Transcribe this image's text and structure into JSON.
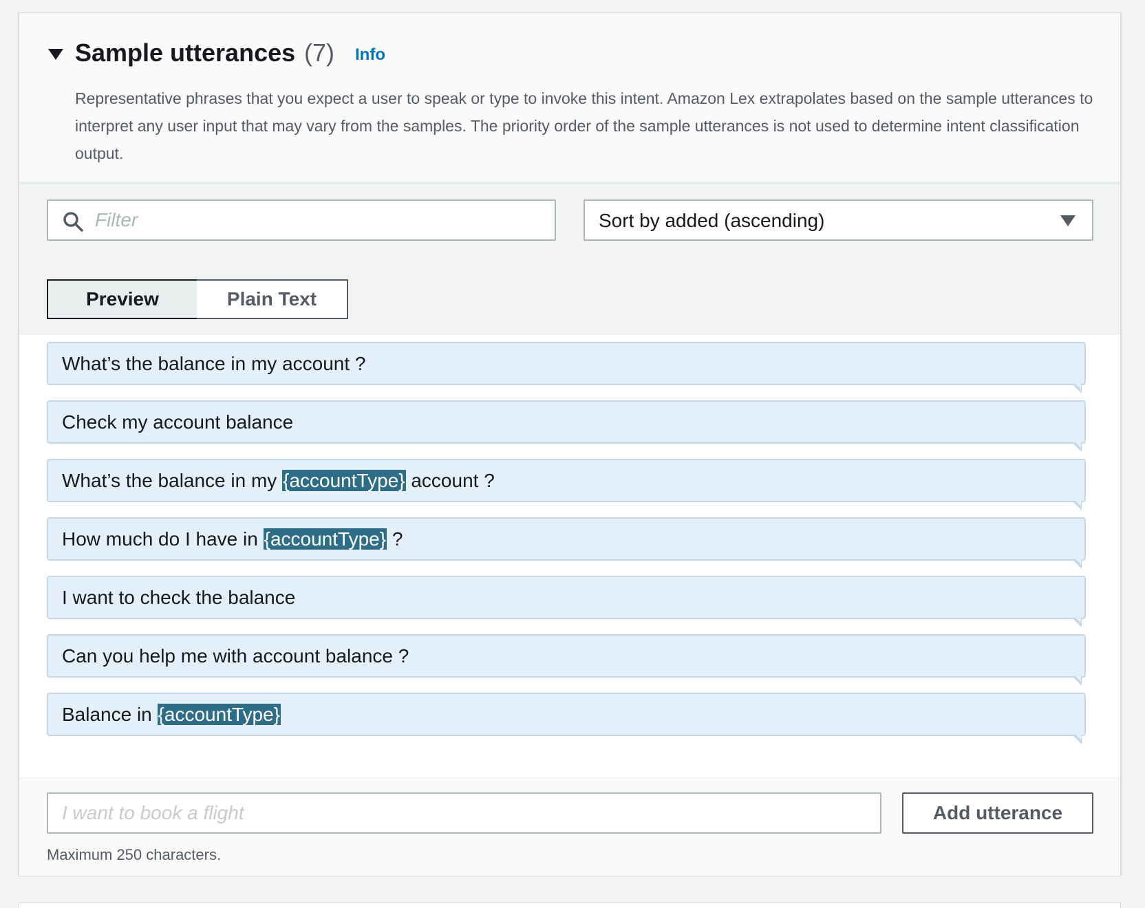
{
  "section": {
    "title": "Sample utterances",
    "count": "(7)",
    "info_label": "Info",
    "description": "Representative phrases that you expect a user to speak or type to invoke this intent. Amazon Lex extrapolates based on the sample utterances to interpret any user input that may vary from the samples. The priority order of the sample utterances is not used to determine intent classification output."
  },
  "filter": {
    "placeholder": "Filter",
    "value": "",
    "icon": "search-icon"
  },
  "sort": {
    "selected": "Sort by added (ascending)",
    "icon": "caret-down-icon"
  },
  "view_toggle": {
    "preview_label": "Preview",
    "plain_label": "Plain Text",
    "active": "preview"
  },
  "utterances": [
    {
      "parts": [
        {
          "text": "What’s the balance in my account ?",
          "slot": false
        }
      ]
    },
    {
      "parts": [
        {
          "text": "Check my account balance",
          "slot": false
        }
      ]
    },
    {
      "parts": [
        {
          "text": "What’s the balance in my ",
          "slot": false
        },
        {
          "text": "{accountType}",
          "slot": true
        },
        {
          "text": " account ?",
          "slot": false
        }
      ]
    },
    {
      "parts": [
        {
          "text": "How much do I have in ",
          "slot": false
        },
        {
          "text": "{accountType}",
          "slot": true
        },
        {
          "text": " ?",
          "slot": false
        }
      ]
    },
    {
      "parts": [
        {
          "text": "I want to check the balance",
          "slot": false
        }
      ]
    },
    {
      "parts": [
        {
          "text": "Can you help me with account balance ?",
          "slot": false
        }
      ]
    },
    {
      "parts": [
        {
          "text": "Balance in ",
          "slot": false
        },
        {
          "text": "{accountType}",
          "slot": true
        }
      ]
    }
  ],
  "new_utterance": {
    "placeholder": "I want to book a flight",
    "value": "",
    "button_label": "Add utterance",
    "hint": "Maximum 250 characters."
  },
  "colors": {
    "utterance_bg": "#e3f0fa",
    "slot_bg": "#2e6d88",
    "link": "#0073bb"
  }
}
